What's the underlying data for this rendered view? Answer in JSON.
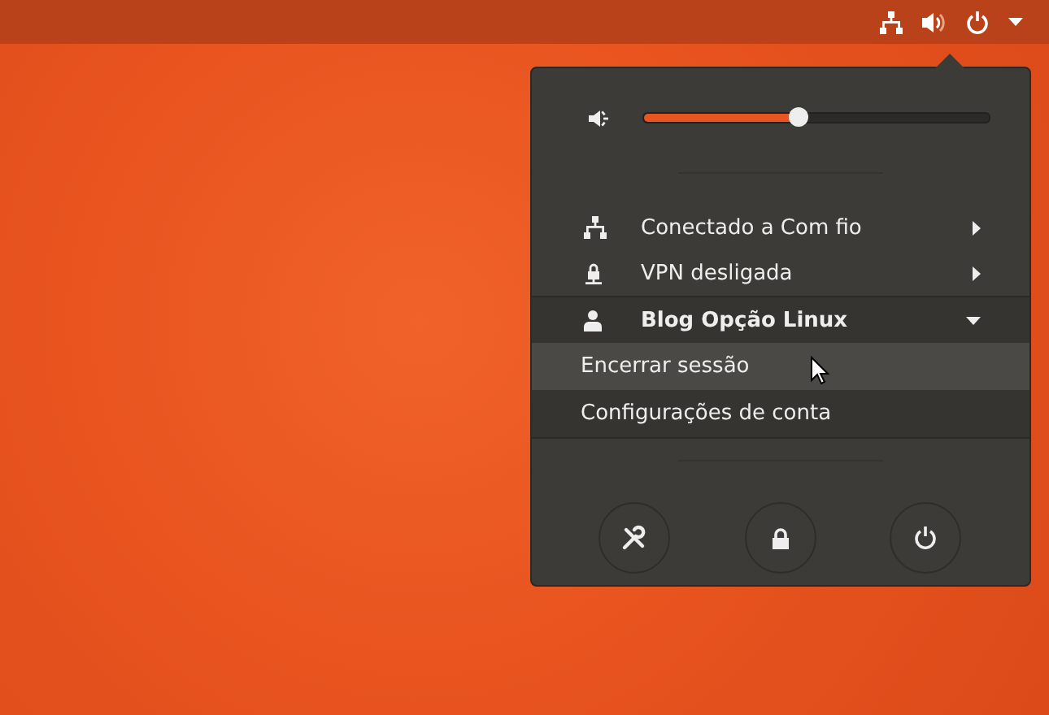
{
  "volume": {
    "level": 0.45
  },
  "items": [
    {
      "kind": "network",
      "label": "Conectado a Com fio",
      "expanded": false
    },
    {
      "kind": "vpn",
      "label": "VPN desligada",
      "expanded": false
    },
    {
      "kind": "user",
      "label": "Blog Opção Linux",
      "expanded": true,
      "children": [
        {
          "label": "Encerrar sessão",
          "selected": true
        },
        {
          "label": "Configurações de conta",
          "selected": false
        }
      ]
    }
  ]
}
